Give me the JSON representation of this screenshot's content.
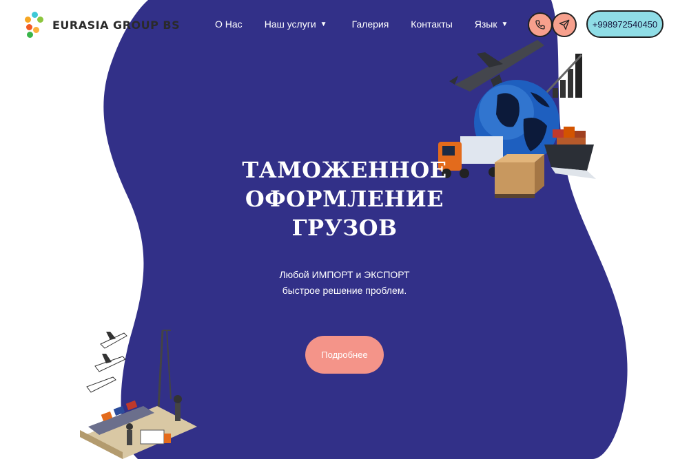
{
  "logo": {
    "text": "EURASIA GROUP BS"
  },
  "nav": {
    "about": "О Нас",
    "services": "Наш услуги",
    "gallery": "Галерия",
    "contacts": "Контакты",
    "language": "Язык"
  },
  "contact": {
    "phone": "+998972540450"
  },
  "hero": {
    "title_line1": "ТАМОЖЕННОЕ",
    "title_line2": "ОФОРМЛЕНИЕ",
    "title_line3": "ГРУЗОВ",
    "subtitle_line1": "Любой ИМПОРТ и ЭКСПОРТ",
    "subtitle_line2": "быстрое решение проблем.",
    "cta": "Подробнее"
  },
  "colors": {
    "hero_bg": "#323088",
    "accent_coral": "#f49489",
    "accent_cyan": "#8fdde6"
  },
  "icons": {
    "call": "phone-icon",
    "telegram": "paper-plane-icon",
    "dropdown": "caret-down-icon"
  }
}
